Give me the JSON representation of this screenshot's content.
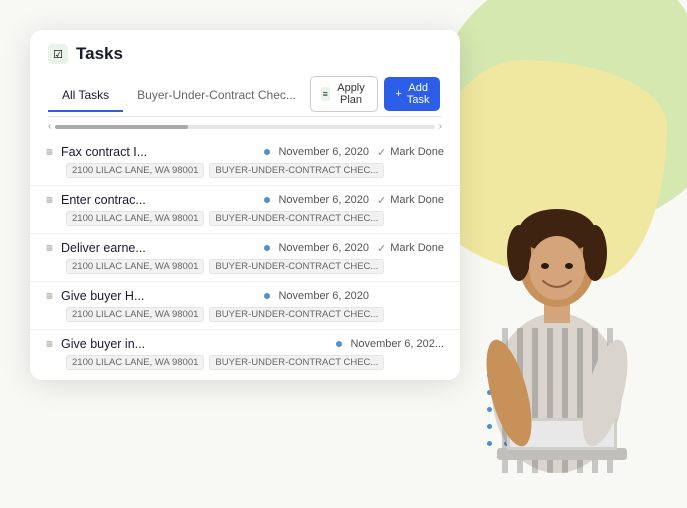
{
  "background": {
    "blob_green_color": "#c8e6a0",
    "blob_yellow_color": "#ede89a"
  },
  "card": {
    "title": "Tasks",
    "title_icon": "☑",
    "tabs": [
      {
        "label": "All Tasks",
        "active": true
      },
      {
        "label": "Buyer-Under-Contract Chec...",
        "active": false
      }
    ],
    "buttons": {
      "apply_plan": "Apply Plan",
      "add_task": "Add Task",
      "add_icon": "+"
    },
    "tasks": [
      {
        "name": "Fax contract I...",
        "date": "November 6, 2020",
        "mark_done": true,
        "tags": [
          "2100 LILAC LANE, WA 98001",
          "BUYER-UNDER-CONTRACT CHEC..."
        ]
      },
      {
        "name": "Enter contrac...",
        "date": "November 6, 2020",
        "mark_done": true,
        "tags": [
          "2100 LILAC LANE, WA 98001",
          "BUYER-UNDER-CONTRACT CHEC..."
        ]
      },
      {
        "name": "Deliver earne...",
        "date": "November 6, 2020",
        "mark_done": true,
        "tags": [
          "2100 LILAC LANE, WA 98001",
          "BUYER-UNDER-CONTRACT CHEC..."
        ]
      },
      {
        "name": "Give buyer H...",
        "date": "November 6, 2020",
        "mark_done": false,
        "tags": [
          "2100 LILAC LANE, WA 98001",
          "BUYER-UNDER-CONTRACT CHEC..."
        ]
      },
      {
        "name": "Give buyer in...",
        "date": "November 6, 202...",
        "mark_done": false,
        "tags": [
          "2100 LILAC LANE, WA 98001",
          "BUYER-UNDER-CONTRACT CHEC..."
        ]
      }
    ]
  }
}
